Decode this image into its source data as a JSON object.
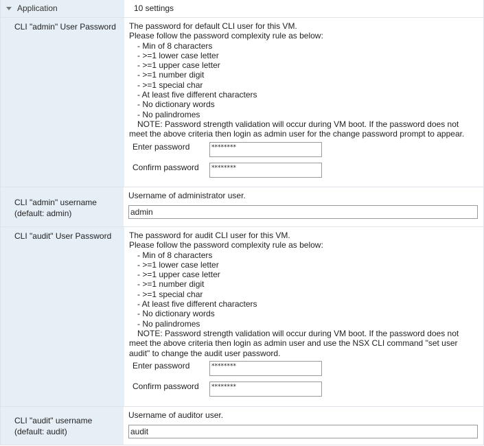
{
  "header": {
    "label": "Application",
    "count": "10 settings"
  },
  "settings": [
    {
      "label": "CLI \"admin\" User Password",
      "desc": [
        "The password for default CLI user for this VM.",
        "Please follow the password complexity rule as below:"
      ],
      "rules": [
        "- Min of 8 characters",
        "- >=1 lower case letter",
        "- >=1 upper case letter",
        "- >=1 number digit",
        "- >=1 special char",
        "- At least five different characters",
        "- No dictionary words",
        "- No palindromes"
      ],
      "note": "NOTE: Password strength validation will occur during VM boot. If the password does not",
      "note2": "meet the above criteria then login as admin user for the change password prompt to appear.",
      "enter_label": "Enter password",
      "enter_value": "********",
      "confirm_label": "Confirm password",
      "confirm_value": "********"
    },
    {
      "label": "CLI \"admin\" username (default: admin)",
      "desc": "Username of administrator user.",
      "value": "admin"
    },
    {
      "label": "CLI \"audit\" User Password",
      "desc": [
        "The password for audit CLI user for this VM.",
        "Please follow the password complexity rule as below:"
      ],
      "rules": [
        "- Min of 8 characters",
        "- >=1 lower case letter",
        "- >=1 upper case letter",
        "- >=1 number digit",
        "- >=1 special char",
        "- At least five different characters",
        "- No dictionary words",
        "- No palindromes"
      ],
      "note": "NOTE: Password strength validation will occur during VM boot.  If the password does not",
      "note2": "meet the above criteria then login as admin user and use the NSX CLI command \"set user audit\" to change the audit user password.",
      "enter_label": "Enter password",
      "enter_value": "********",
      "confirm_label": "Confirm password",
      "confirm_value": "********"
    },
    {
      "label": "CLI \"audit\" username (default: audit)",
      "desc": "Username of auditor user.",
      "value": "audit"
    }
  ]
}
